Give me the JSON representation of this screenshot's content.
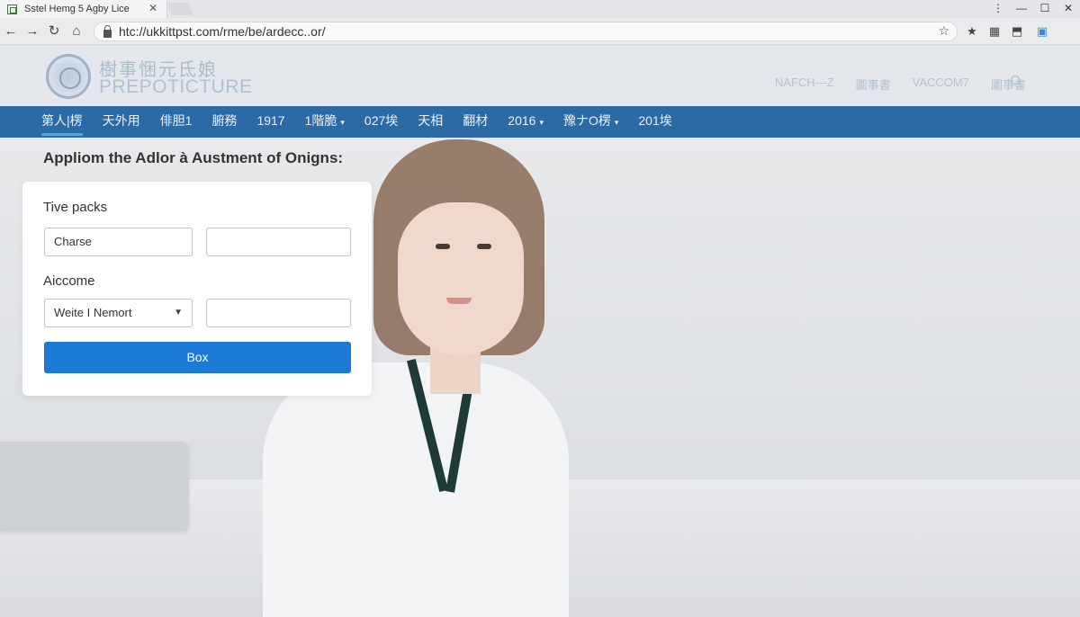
{
  "browser": {
    "tab_title": "Sstel Hemg 5 Agby Lice",
    "tab_close": "✕",
    "url": "htc://ukkittpst.com/rme/be/ardecc..or/",
    "window_controls": [
      "⋮",
      "—",
      "☐",
      "✕"
    ],
    "nav_icons": [
      "←",
      "→",
      "↻",
      "⌂"
    ],
    "right_icons": [
      "☆",
      "★",
      "▦",
      "⬒",
      "▣"
    ]
  },
  "site": {
    "logo_cjk": "樹事悃元氐娘",
    "logo_word": "PREPOTICTURE",
    "header_links": [
      "NAFCH—Z",
      "圖事書",
      "VACCOM7",
      "圖事書"
    ],
    "nav_items": [
      {
        "label": "第人|楞",
        "dropdown": false,
        "active": true
      },
      {
        "label": "天外用",
        "dropdown": false,
        "active": false
      },
      {
        "label": "俳胆1",
        "dropdown": false,
        "active": false
      },
      {
        "label": "腑務",
        "dropdown": false,
        "active": false
      },
      {
        "label": "1917",
        "dropdown": false,
        "active": false
      },
      {
        "label": "1階脆",
        "dropdown": true,
        "active": false
      },
      {
        "label": "027埃",
        "dropdown": false,
        "active": false
      },
      {
        "label": "天相",
        "dropdown": false,
        "active": false
      },
      {
        "label": "翻材",
        "dropdown": false,
        "active": false
      },
      {
        "label": "2016",
        "dropdown": true,
        "active": false
      },
      {
        "label": "豫ナO楞",
        "dropdown": true,
        "active": false
      },
      {
        "label": "201埃",
        "dropdown": false,
        "active": false
      }
    ]
  },
  "main": {
    "heading": "Appliom the Adlor à Austment of Onigns:",
    "form": {
      "section1_label": "Tive packs",
      "field1_value": "Charse",
      "field2_value": "",
      "section2_label": "Aiccome",
      "select_value": "Weite I Nemort",
      "field3_value": "",
      "submit_label": "Box"
    }
  },
  "colors": {
    "nav_bar": "#2c6aa6",
    "primary_button": "#1a7ad6",
    "header_bg": "#e4e8ec"
  }
}
